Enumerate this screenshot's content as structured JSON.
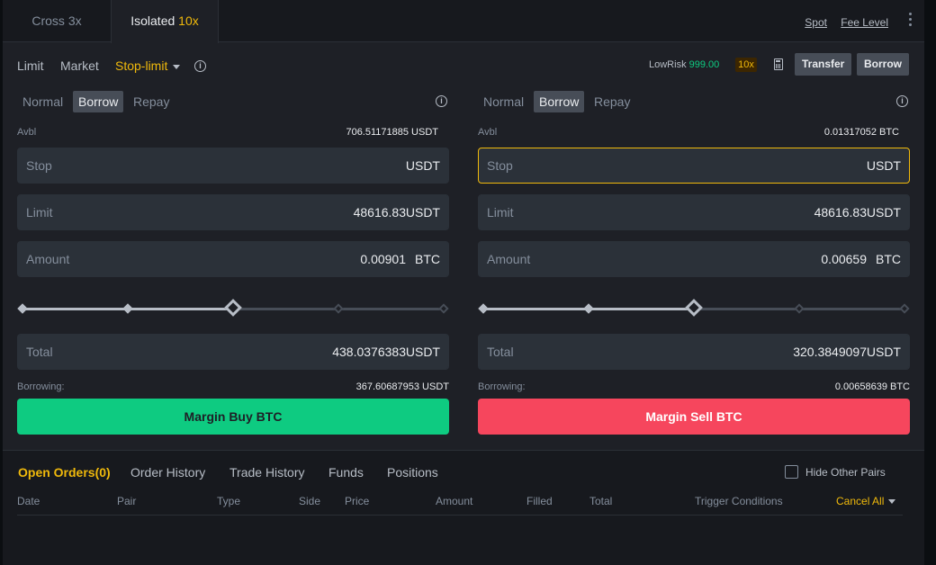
{
  "mode_tabs": {
    "cross": "Cross 3x",
    "isolated_label": "Isolated",
    "isolated_leverage": "10x"
  },
  "top_links": {
    "spot": "Spot",
    "fee_level": "Fee Level"
  },
  "order_types": {
    "limit": "Limit",
    "market": "Market",
    "stop_limit": "Stop-limit",
    "active": "Stop-limit"
  },
  "risk": {
    "label": "LowRisk",
    "value": "999.00",
    "leverage": "10x"
  },
  "buttons": {
    "transfer": "Transfer",
    "borrow": "Borrow"
  },
  "buy": {
    "subtabs": [
      "Normal",
      "Borrow",
      "Repay"
    ],
    "active_subtab": "Borrow",
    "avbl_label": "Avbl",
    "avbl_value": "706.51171885 USDT",
    "stop": {
      "label": "Stop",
      "value": "",
      "unit": "USDT"
    },
    "limit": {
      "label": "Limit",
      "value": "48616.83",
      "unit": "USDT"
    },
    "amount": {
      "label": "Amount",
      "value": "0.00901",
      "unit": "BTC"
    },
    "slider_percent": 50,
    "total": {
      "label": "Total",
      "value": "438.0376383",
      "unit": "USDT"
    },
    "borrowing_label": "Borrowing:",
    "borrowing_value": "367.60687953 USDT",
    "action": "Margin Buy BTC"
  },
  "sell": {
    "subtabs": [
      "Normal",
      "Borrow",
      "Repay"
    ],
    "active_subtab": "Borrow",
    "avbl_label": "Avbl",
    "avbl_value": "0.01317052 BTC",
    "stop": {
      "label": "Stop",
      "value": "",
      "unit": "USDT"
    },
    "limit": {
      "label": "Limit",
      "value": "48616.83",
      "unit": "USDT"
    },
    "amount": {
      "label": "Amount",
      "value": "0.00659",
      "unit": "BTC"
    },
    "slider_percent": 50,
    "total": {
      "label": "Total",
      "value": "320.3849097",
      "unit": "USDT"
    },
    "borrowing_label": "Borrowing:",
    "borrowing_value": "0.00658639 BTC",
    "action": "Margin Sell BTC"
  },
  "orders": {
    "tabs": [
      "Open Orders(0)",
      "Order History",
      "Trade History",
      "Funds",
      "Positions"
    ],
    "hide_other_pairs": "Hide Other Pairs",
    "columns": [
      "Date",
      "Pair",
      "Type",
      "Side",
      "Price",
      "Amount",
      "Filled",
      "Total",
      "Trigger Conditions"
    ],
    "cancel_all": "Cancel All"
  },
  "colors": {
    "accent": "#f0b90b",
    "buy": "#0ecb81",
    "sell": "#f6465d",
    "panel": "#1e2026",
    "field": "#2b3139"
  }
}
